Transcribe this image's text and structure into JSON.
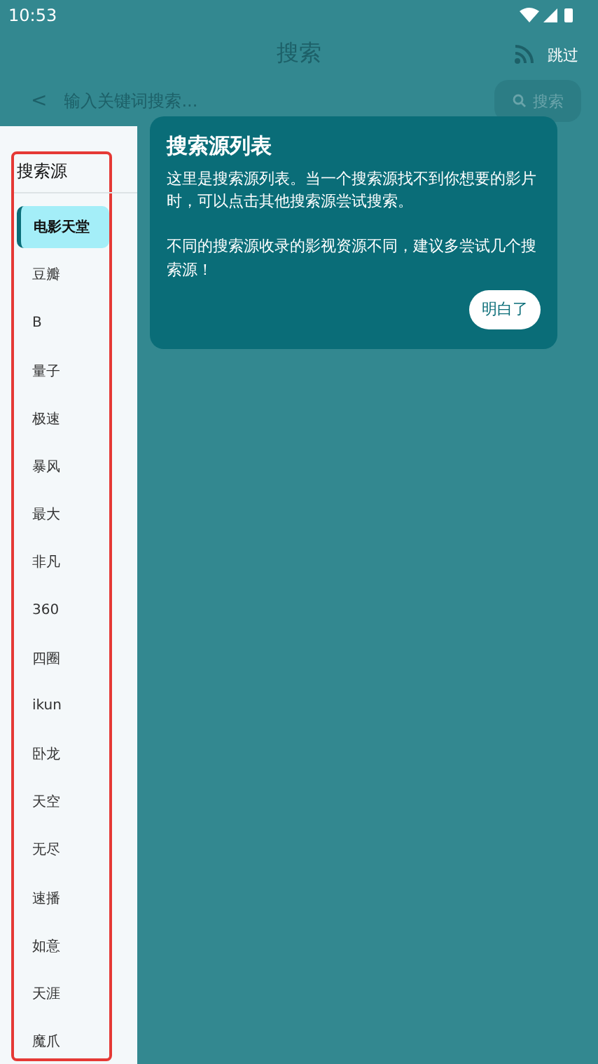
{
  "status_bar": {
    "time": "10:53"
  },
  "header": {
    "title": "搜索",
    "skip": "跳过"
  },
  "search": {
    "back": "<",
    "placeholder": "输入关键词搜索...",
    "button": "搜索"
  },
  "sidebar": {
    "title": "搜索源",
    "highlighted": true,
    "items": [
      {
        "label": "电影天堂",
        "selected": true
      },
      {
        "label": "豆瓣",
        "selected": false
      },
      {
        "label": "B",
        "selected": false
      },
      {
        "label": "量子",
        "selected": false
      },
      {
        "label": "极速",
        "selected": false
      },
      {
        "label": "暴风",
        "selected": false
      },
      {
        "label": "最大",
        "selected": false
      },
      {
        "label": "非凡",
        "selected": false
      },
      {
        "label": "360",
        "selected": false
      },
      {
        "label": "四圈",
        "selected": false
      },
      {
        "label": "ikun",
        "selected": false
      },
      {
        "label": "卧龙",
        "selected": false
      },
      {
        "label": "天空",
        "selected": false
      },
      {
        "label": "无尽",
        "selected": false
      },
      {
        "label": "速播",
        "selected": false
      },
      {
        "label": "如意",
        "selected": false
      },
      {
        "label": "天涯",
        "selected": false
      },
      {
        "label": "魔爪",
        "selected": false
      }
    ]
  },
  "tooltip": {
    "title": "搜索源列表",
    "paragraphs": [
      "这里是搜索源列表。当一个搜索源找不到你想要的影片时，可以点击其他搜索源尝试搜索。",
      "不同的搜索源收录的影视资源不同，建议多尝试几个搜索源！"
    ],
    "button": "明白了"
  }
}
